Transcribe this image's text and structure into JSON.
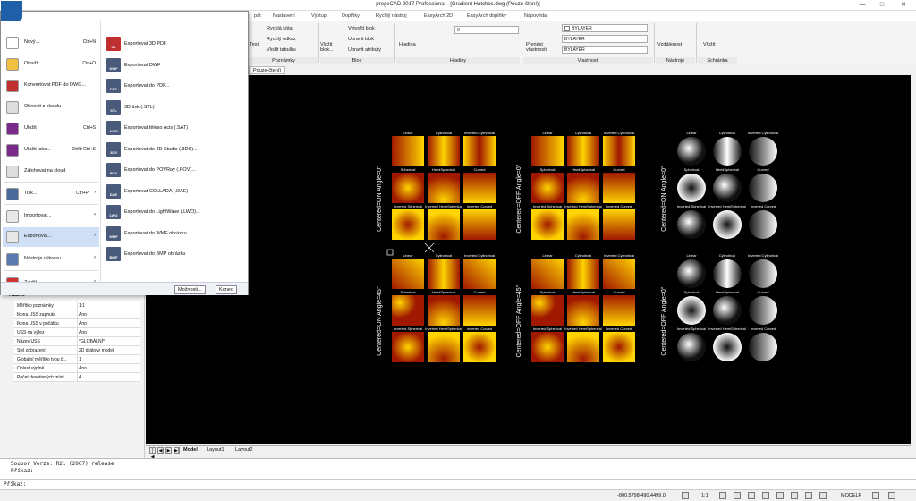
{
  "window": {
    "title": "progeCAD 2017 Professional - [Gradient Hatches.dwg (Pouze-čtení)]",
    "min": "—",
    "max": "□",
    "close": "✕"
  },
  "tabs": [
    "pát",
    "Nastavení",
    "Výstup",
    "Doplňky",
    "Rychlý nástroj",
    "EasyArch 2D",
    "EasyArch doplňky",
    "Nápověda"
  ],
  "ribbon": {
    "text_btn": "Text",
    "quick_dim": "Rychlá kóta",
    "quick_leader": "Rychlý odkaz",
    "insert_table": "Vložit tabulku",
    "group_notes": "Poznámky",
    "insert_block": "Vložit blok...",
    "create_block": "Vytvořit blok",
    "edit_block": "Upravit blok",
    "edit_attrs": "Upravit atributy",
    "group_block": "Blok",
    "layer_btn": "Hladina",
    "layer_value": "0",
    "group_layers": "Hladiny",
    "match_props": "Přenést vlastnosti",
    "bylayer1": "BYLAYER",
    "bylayer2": "BYLAYER",
    "bylayer3": "BYLAYER",
    "group_props": "Vlastnosti",
    "distance": "Vzdálenost",
    "group_tools": "Nástroje",
    "paste": "Vložit",
    "group_clipboard": "Schránka"
  },
  "doc_tab": "Pouze-čtení)",
  "app_menu": {
    "left": [
      {
        "label": "Nový...",
        "shortcut": "Ctrl+N",
        "color": "#ffffff"
      },
      {
        "label": "Otevřít...",
        "shortcut": "Ctrl+O",
        "color": "#f0c040"
      },
      {
        "label": "Konvertovat PDF do DWG...",
        "shortcut": "",
        "color": "#c03030"
      },
      {
        "label": "Obnovit z cloudu",
        "shortcut": "",
        "color": "#dddddd"
      },
      {
        "label": "Uložit",
        "shortcut": "Ctrl+S",
        "color": "#7a2a8a"
      },
      {
        "label": "Uložit jako...",
        "shortcut": "Shift+Ctrl+S",
        "color": "#7a2a8a"
      },
      {
        "label": "Zálohovat na cloud",
        "shortcut": "",
        "color": "#dddddd"
      },
      {
        "label": "Tisk...",
        "shortcut": "Ctrl+P",
        "color": "#4a6a9a"
      },
      {
        "label": "Importovat...",
        "shortcut": "",
        "color": "#e8e8e8"
      },
      {
        "label": "Exportovat...",
        "shortcut": "",
        "color": "#e8e8e8"
      },
      {
        "label": "Nástroje výkresu",
        "shortcut": "",
        "color": "#5a7ab0"
      },
      {
        "label": "Zavřít",
        "shortcut": "",
        "color": "#d03030"
      }
    ],
    "right": [
      {
        "label": "Exportovat 3D PDF",
        "tag": "3D",
        "color": "#c03030"
      },
      {
        "label": "Exportovat DWF",
        "tag": "DWF",
        "color": "#4a5a7a"
      },
      {
        "label": "Exportovat do PDF...",
        "tag": "PDF",
        "color": "#4a5a7a"
      },
      {
        "label": "3D tisk (.STL)",
        "tag": "STL",
        "color": "#4a5a7a"
      },
      {
        "label": "Exportovat těleso Acis (.SAT)",
        "tag": "ACIS",
        "color": "#4a5a7a"
      },
      {
        "label": "Exportovat do 3D Studio (.3DS)...",
        "tag": "3DS",
        "color": "#4a5a7a"
      },
      {
        "label": "Exportovat do POVRay (.POV)...",
        "tag": "POV",
        "color": "#4a5a7a"
      },
      {
        "label": "Exportovat COLLADA (.DAE)",
        "tag": "DAE",
        "color": "#4a5a7a"
      },
      {
        "label": "Exportovat do LightWave (.LWO)...",
        "tag": "LWO",
        "color": "#4a5a7a"
      },
      {
        "label": "Exportovat do WMF obrázku",
        "tag": "WMF",
        "color": "#4a5a7a"
      },
      {
        "label": "Exportovat do BMP obrázku",
        "tag": "BMP",
        "color": "#4a5a7a"
      }
    ],
    "options_btn": "Možnosti...",
    "exit_btn": "Konec"
  },
  "properties": {
    "title": "Různé",
    "rows": [
      {
        "key": "Měřítko poznámky",
        "value": "1:1"
      },
      {
        "key": "Ikona USS zapnuta",
        "value": "Ano"
      },
      {
        "key": "Ikona USS v počátku",
        "value": "Ano"
      },
      {
        "key": "USS na výřez",
        "value": "Ano"
      },
      {
        "key": "Název USS",
        "value": "*GLOBÁLNÍ*"
      },
      {
        "key": "Styl zobrazení",
        "value": "2D drátový model"
      },
      {
        "key": "Globální měřítko typu č...",
        "value": "1"
      },
      {
        "key": "Oblast výplně",
        "value": "Ano"
      },
      {
        "key": "Počet desetinných míst",
        "value": "4"
      }
    ]
  },
  "drawing": {
    "group1_side": "Centered=ON  Angle=0°",
    "group2_side": "Centered=OFF  Angle=0°",
    "group3_side": "Centered=ON  Angle=0°",
    "group4_side": "Centered=ON  Angle=45°",
    "group5_side": "Centered=OFF  Angle=45°",
    "group6_side": "Centered=OFF  Angle=0°",
    "row1_labels": [
      "Linear",
      "Cylindrical",
      "Inverted Cylindrical"
    ],
    "row2_labels": [
      "Spherical",
      "HemiSpherical",
      "Curved"
    ],
    "row3_labels": [
      "Inverted Spherical",
      "Inverted HemiSpherical",
      "Inverted Curved"
    ],
    "tile_light": "#ffd400",
    "tile_dark": "#a01800"
  },
  "layout_tabs": [
    "Model",
    "Layout1",
    "Layout2"
  ],
  "command": {
    "line1": "Soubor Verze: R21 (2007) release",
    "line2": "Příkaz:",
    "prompt": "Příkaz:"
  },
  "status": {
    "coords": "-800.5798,490.4499,0",
    "scale": "1:1",
    "modelp": "MODELP"
  }
}
